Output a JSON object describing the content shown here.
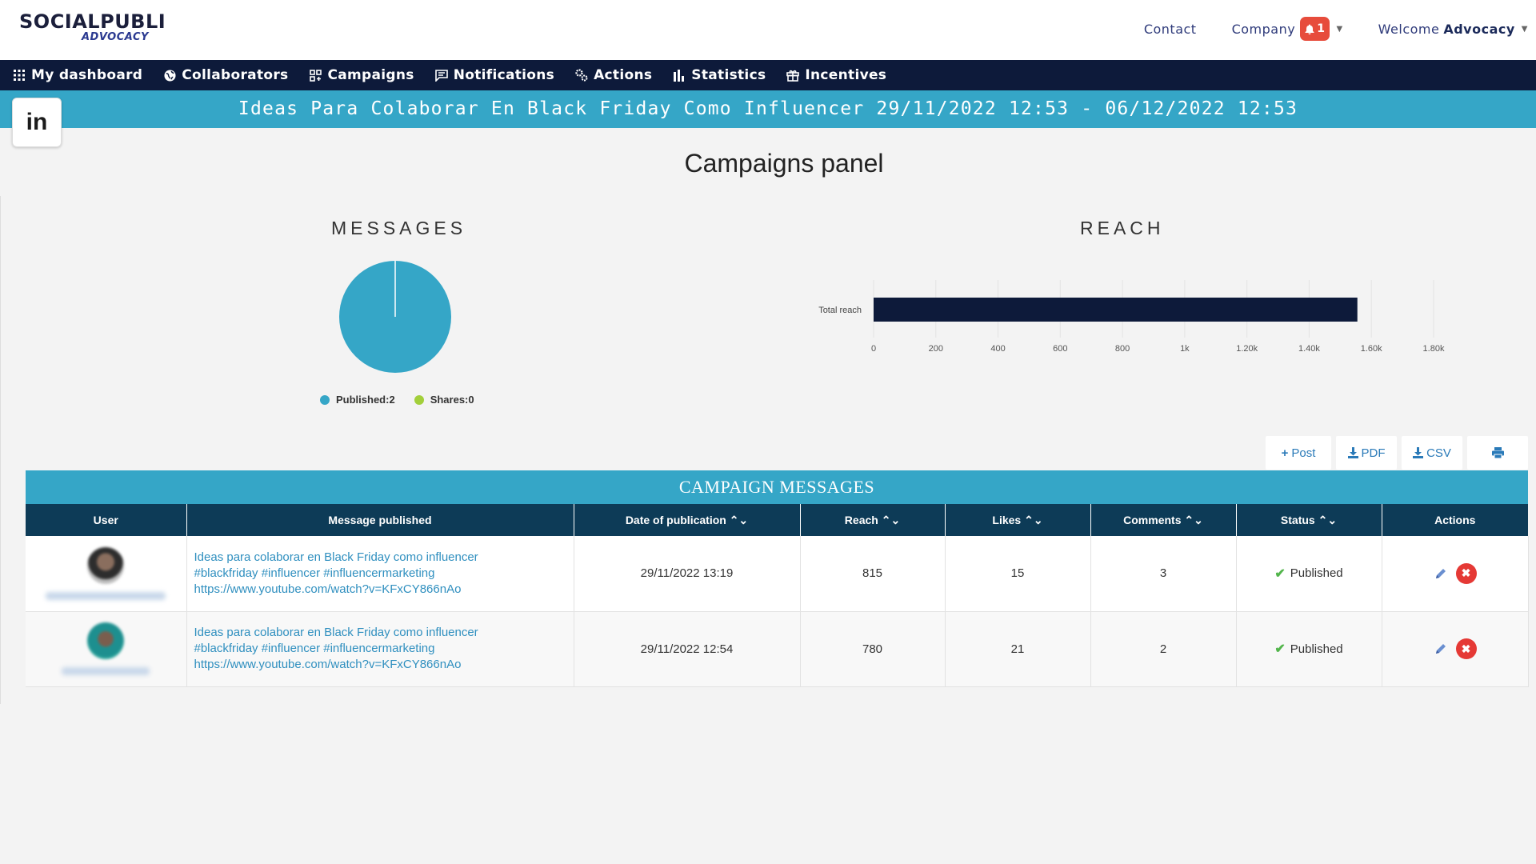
{
  "header": {
    "logo_line1": "SOCIALPUBLI",
    "logo_line2": "ADVOCACY",
    "contact": "Contact",
    "company": "Company",
    "notif_count": "1",
    "welcome": "Welcome",
    "user": "Advocacy"
  },
  "nav": [
    {
      "label": "My dashboard",
      "icon": "grid-icon"
    },
    {
      "label": "Collaborators",
      "icon": "globe-icon"
    },
    {
      "label": "Campaigns",
      "icon": "campaigns-icon"
    },
    {
      "label": "Notifications",
      "icon": "comment-icon"
    },
    {
      "label": "Actions",
      "icon": "gears-icon"
    },
    {
      "label": "Statistics",
      "icon": "bar-chart-icon"
    },
    {
      "label": "Incentives",
      "icon": "gift-icon"
    }
  ],
  "campaign_banner": "Ideas Para Colaborar En Black Friday Como Influencer 29/11/2022 12:53 - 06/12/2022 12:53",
  "network_badge": "in",
  "panel_title": "Campaigns panel",
  "chart_data": [
    {
      "type": "pie",
      "title": "MESSAGES",
      "slices": [
        {
          "name": "Published",
          "value": 2,
          "color": "#35a6c7"
        },
        {
          "name": "Shares",
          "value": 0,
          "color": "#a2cf3a"
        }
      ],
      "legend": [
        "Published:2",
        "Shares:0"
      ]
    },
    {
      "type": "bar",
      "title": "REACH",
      "orientation": "horizontal",
      "categories": [
        "Total reach"
      ],
      "values": [
        1555
      ],
      "xlim": [
        0,
        1800
      ],
      "ticks": [
        {
          "value": 0,
          "label": "0"
        },
        {
          "value": 200,
          "label": "200"
        },
        {
          "value": 400,
          "label": "400"
        },
        {
          "value": 600,
          "label": "600"
        },
        {
          "value": 800,
          "label": "800"
        },
        {
          "value": 1000,
          "label": "1k"
        },
        {
          "value": 1200,
          "label": "1.20k"
        },
        {
          "value": 1400,
          "label": "1.40k"
        },
        {
          "value": 1600,
          "label": "1.60k"
        },
        {
          "value": 1800,
          "label": "1.80k"
        }
      ],
      "bar_color": "#0d1a3a",
      "grid": true
    }
  ],
  "buttons": {
    "post": "Post",
    "pdf": "PDF",
    "csv": "CSV"
  },
  "table": {
    "title": "CAMPAIGN MESSAGES",
    "columns": [
      "User",
      "Message published",
      "Date of publication",
      "Reach",
      "Likes",
      "Comments",
      "Status",
      "Actions"
    ],
    "rows": [
      {
        "message_line1": "Ideas para colaborar en Black Friday como influencer",
        "message_line2": "#blackfriday #influencer #influencermarketing",
        "message_line3": "https://www.youtube.com/watch?v=KFxCY866nAo",
        "date": "29/11/2022 13:19",
        "reach": "815",
        "likes": "15",
        "comments": "3",
        "status": "Published"
      },
      {
        "message_line1": "Ideas para colaborar en Black Friday como influencer",
        "message_line2": "#blackfriday #influencer #influencermarketing",
        "message_line3": "https://www.youtube.com/watch?v=KFxCY866nAo",
        "date": "29/11/2022 12:54",
        "reach": "780",
        "likes": "21",
        "comments": "2",
        "status": "Published"
      }
    ]
  }
}
